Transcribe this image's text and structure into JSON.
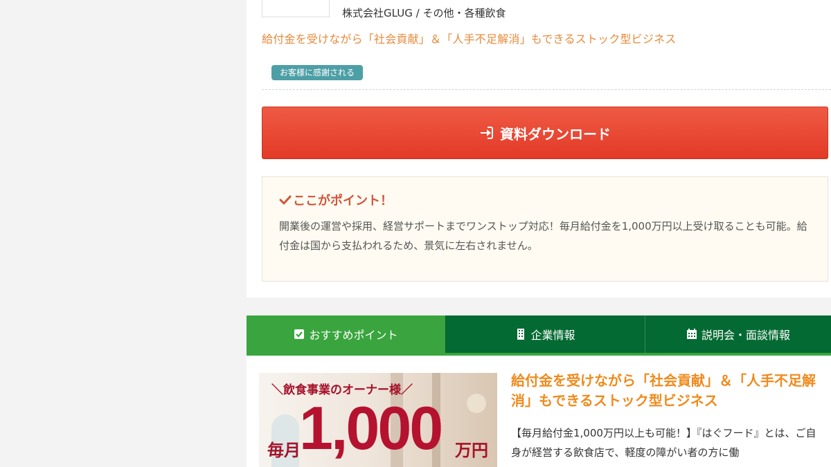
{
  "company": {
    "name": "株式会社GLUG",
    "separator": "/",
    "category": "その他・各種飲食"
  },
  "catchphrase": "給付金を受けながら「社会貢献」＆「人手不足解消」もできるストック型ビジネス",
  "badge": "お客様に感謝される",
  "download_button": {
    "label": "資料ダウンロード",
    "icon": "sign-in-icon"
  },
  "point": {
    "title": "ここがポイント！",
    "body": "開業後の運営や採用、経営サポートまでワンストップ対応！毎月給付金を1,000万円以上受け取ることも可能。給付金は国から支払われるため、景気に左右されません。"
  },
  "tabs": [
    {
      "label": "おすすめポイント",
      "icon": "checkbox-icon",
      "active": true
    },
    {
      "label": "企業情報",
      "icon": "building-icon",
      "active": false
    },
    {
      "label": "説明会・面談情報",
      "icon": "calendar-icon",
      "active": false
    }
  ],
  "promo_image": {
    "subtitle": "＼飲食事業のオーナー様／",
    "prefix": "毎月",
    "amount": "1,000",
    "unit": "万円"
  },
  "article": {
    "title": "給付金を受けながら「社会貢献」＆「人手不足解消」もできるストック型ビジネス",
    "body": "【毎月給付金1,000万円以上も可能！】『はぐフード』とは、ご自身が経営する飲食店で、軽度の障がい者の方に働"
  },
  "colors": {
    "accent_orange": "#e88a3a",
    "button_red": "#e23a27",
    "badge_teal": "#4d9fa6",
    "tab_active": "#3aa53e",
    "tab_inactive": "#046a33",
    "point_title": "#d2553a"
  }
}
